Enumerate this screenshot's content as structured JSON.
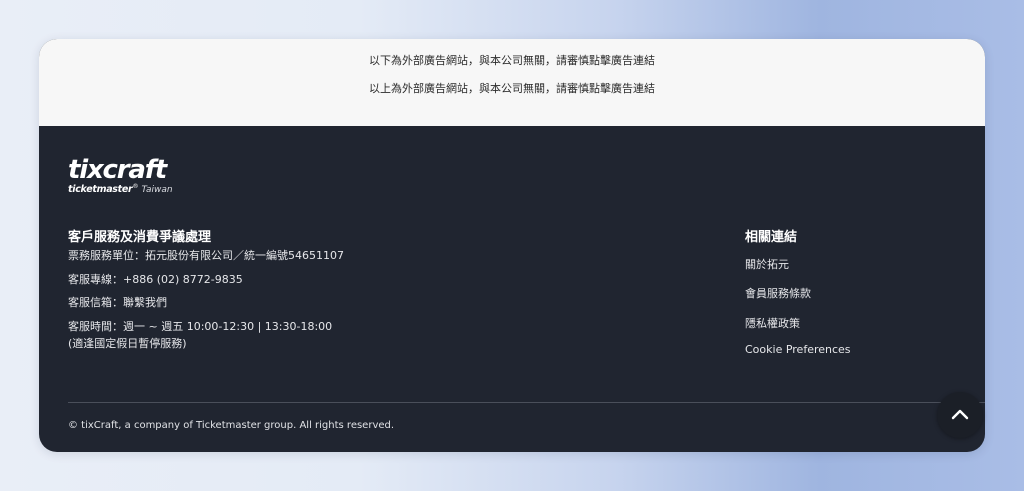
{
  "ad_notice": {
    "line1": "以下為外部廣告網站，與本公司無關，請審慎點擊廣告連結",
    "line2": "以上為外部廣告網站，與本公司無關，請審慎點擊廣告連結"
  },
  "logo": {
    "main": "tixcraft",
    "sub_brand": "ticketmaster",
    "sub_mark": "®",
    "sub_region": "Taiwan"
  },
  "customer_service": {
    "title": "客戶服務及消費爭議處理",
    "unit": "票務服務單位：拓元股份有限公司／統一編號54651107",
    "hotline": "客服專線：+886 (02) 8772-9835",
    "email": "客服信箱：聯繫我們",
    "hours": "客服時間：週一 ~ 週五 10:00-12:30 | 13:30-18:00",
    "hours_note": "(適逢國定假日暫停服務)"
  },
  "related_links": {
    "title": "相關連結",
    "items": [
      {
        "label": "關於拓元"
      },
      {
        "label": "會員服務條款"
      },
      {
        "label": "隱私權政策"
      },
      {
        "label": "Cookie Preferences"
      }
    ]
  },
  "copyright": "© tixCraft, a company of Ticketmaster group. All rights reserved.",
  "icons": {
    "back_to_top": "chevron-up-icon"
  },
  "colors": {
    "footer_bg": "#202530",
    "ad_bg": "#f7f7f7",
    "text_light": "#e6e7ea"
  }
}
